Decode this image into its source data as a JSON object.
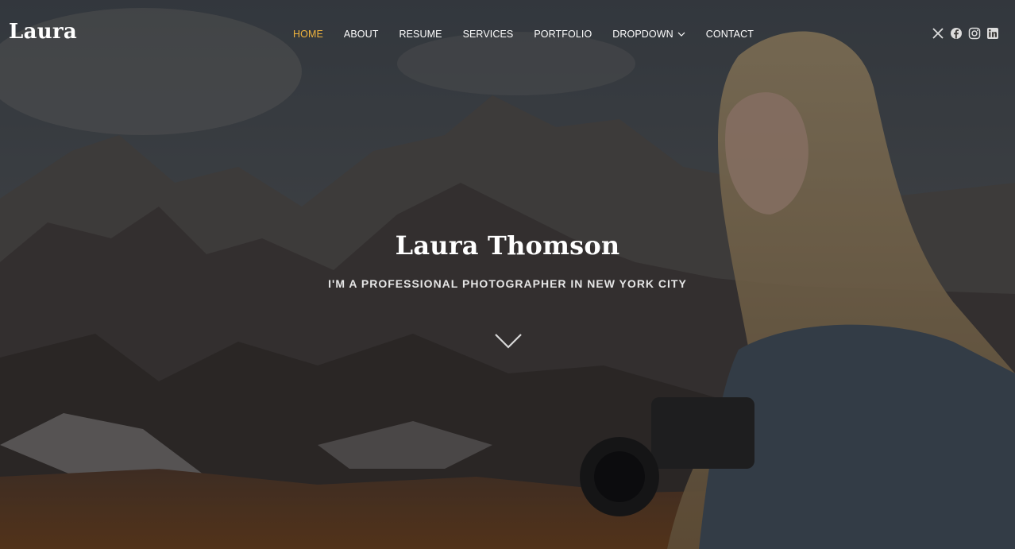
{
  "brand": {
    "logo_text": "Laura"
  },
  "nav": {
    "items": [
      {
        "label": "HOME",
        "active": true
      },
      {
        "label": "ABOUT",
        "active": false
      },
      {
        "label": "RESUME",
        "active": false
      },
      {
        "label": "SERVICES",
        "active": false
      },
      {
        "label": "PORTFOLIO",
        "active": false
      },
      {
        "label": "DROPDOWN",
        "active": false,
        "has_dropdown": true,
        "icon": "chevron-down-icon"
      },
      {
        "label": "CONTACT",
        "active": false
      }
    ]
  },
  "social": [
    "x-twitter-icon",
    "facebook-icon",
    "instagram-icon",
    "linkedin-icon"
  ],
  "hero": {
    "title": "Laura Thomson",
    "subtitle": "I'M A PROFESSIONAL PHOTOGRAPHER IN NEW YORK CITY",
    "scroll_icon": "chevron-down-icon"
  },
  "colors": {
    "accent": "#f0b43d",
    "text": "#ffffff",
    "overlay": "#0a0a0c"
  }
}
